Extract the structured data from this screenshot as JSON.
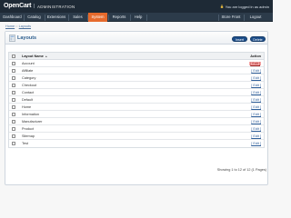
{
  "header": {
    "logo": "OpenCart",
    "separator": "|",
    "subtitle": "ADMINISTRATION",
    "login_status": "You are logged in as admin"
  },
  "menu": {
    "items": [
      {
        "label": "Dashboard"
      },
      {
        "label": "Catalog"
      },
      {
        "label": "Extensions"
      },
      {
        "label": "Sales"
      },
      {
        "label": "System"
      },
      {
        "label": "Reports"
      },
      {
        "label": "Help"
      },
      {
        "label": "Store Front"
      },
      {
        "label": "Logout"
      }
    ],
    "active": "System",
    "active_color": "#e66a2c"
  },
  "breadcrumb": {
    "items": [
      "Home",
      "Layouts"
    ],
    "separator": "::"
  },
  "panel": {
    "title": "Layouts",
    "insert_label": "Insert",
    "delete_label": "Delete"
  },
  "table": {
    "columns": {
      "name": "Layout Name",
      "action": "Action"
    },
    "edit_label": "[ Edit ]",
    "rows": [
      {
        "name": "Account"
      },
      {
        "name": "Affiliate"
      },
      {
        "name": "Category"
      },
      {
        "name": "Checkout"
      },
      {
        "name": "Contact"
      },
      {
        "name": "Default"
      },
      {
        "name": "Home"
      },
      {
        "name": "Information"
      },
      {
        "name": "Manufacturer"
      },
      {
        "name": "Product"
      },
      {
        "name": "Sitemap"
      },
      {
        "name": "Test"
      }
    ]
  },
  "pagination": {
    "text": "Showing 1 to 12 of 12 (1 Pages)"
  }
}
